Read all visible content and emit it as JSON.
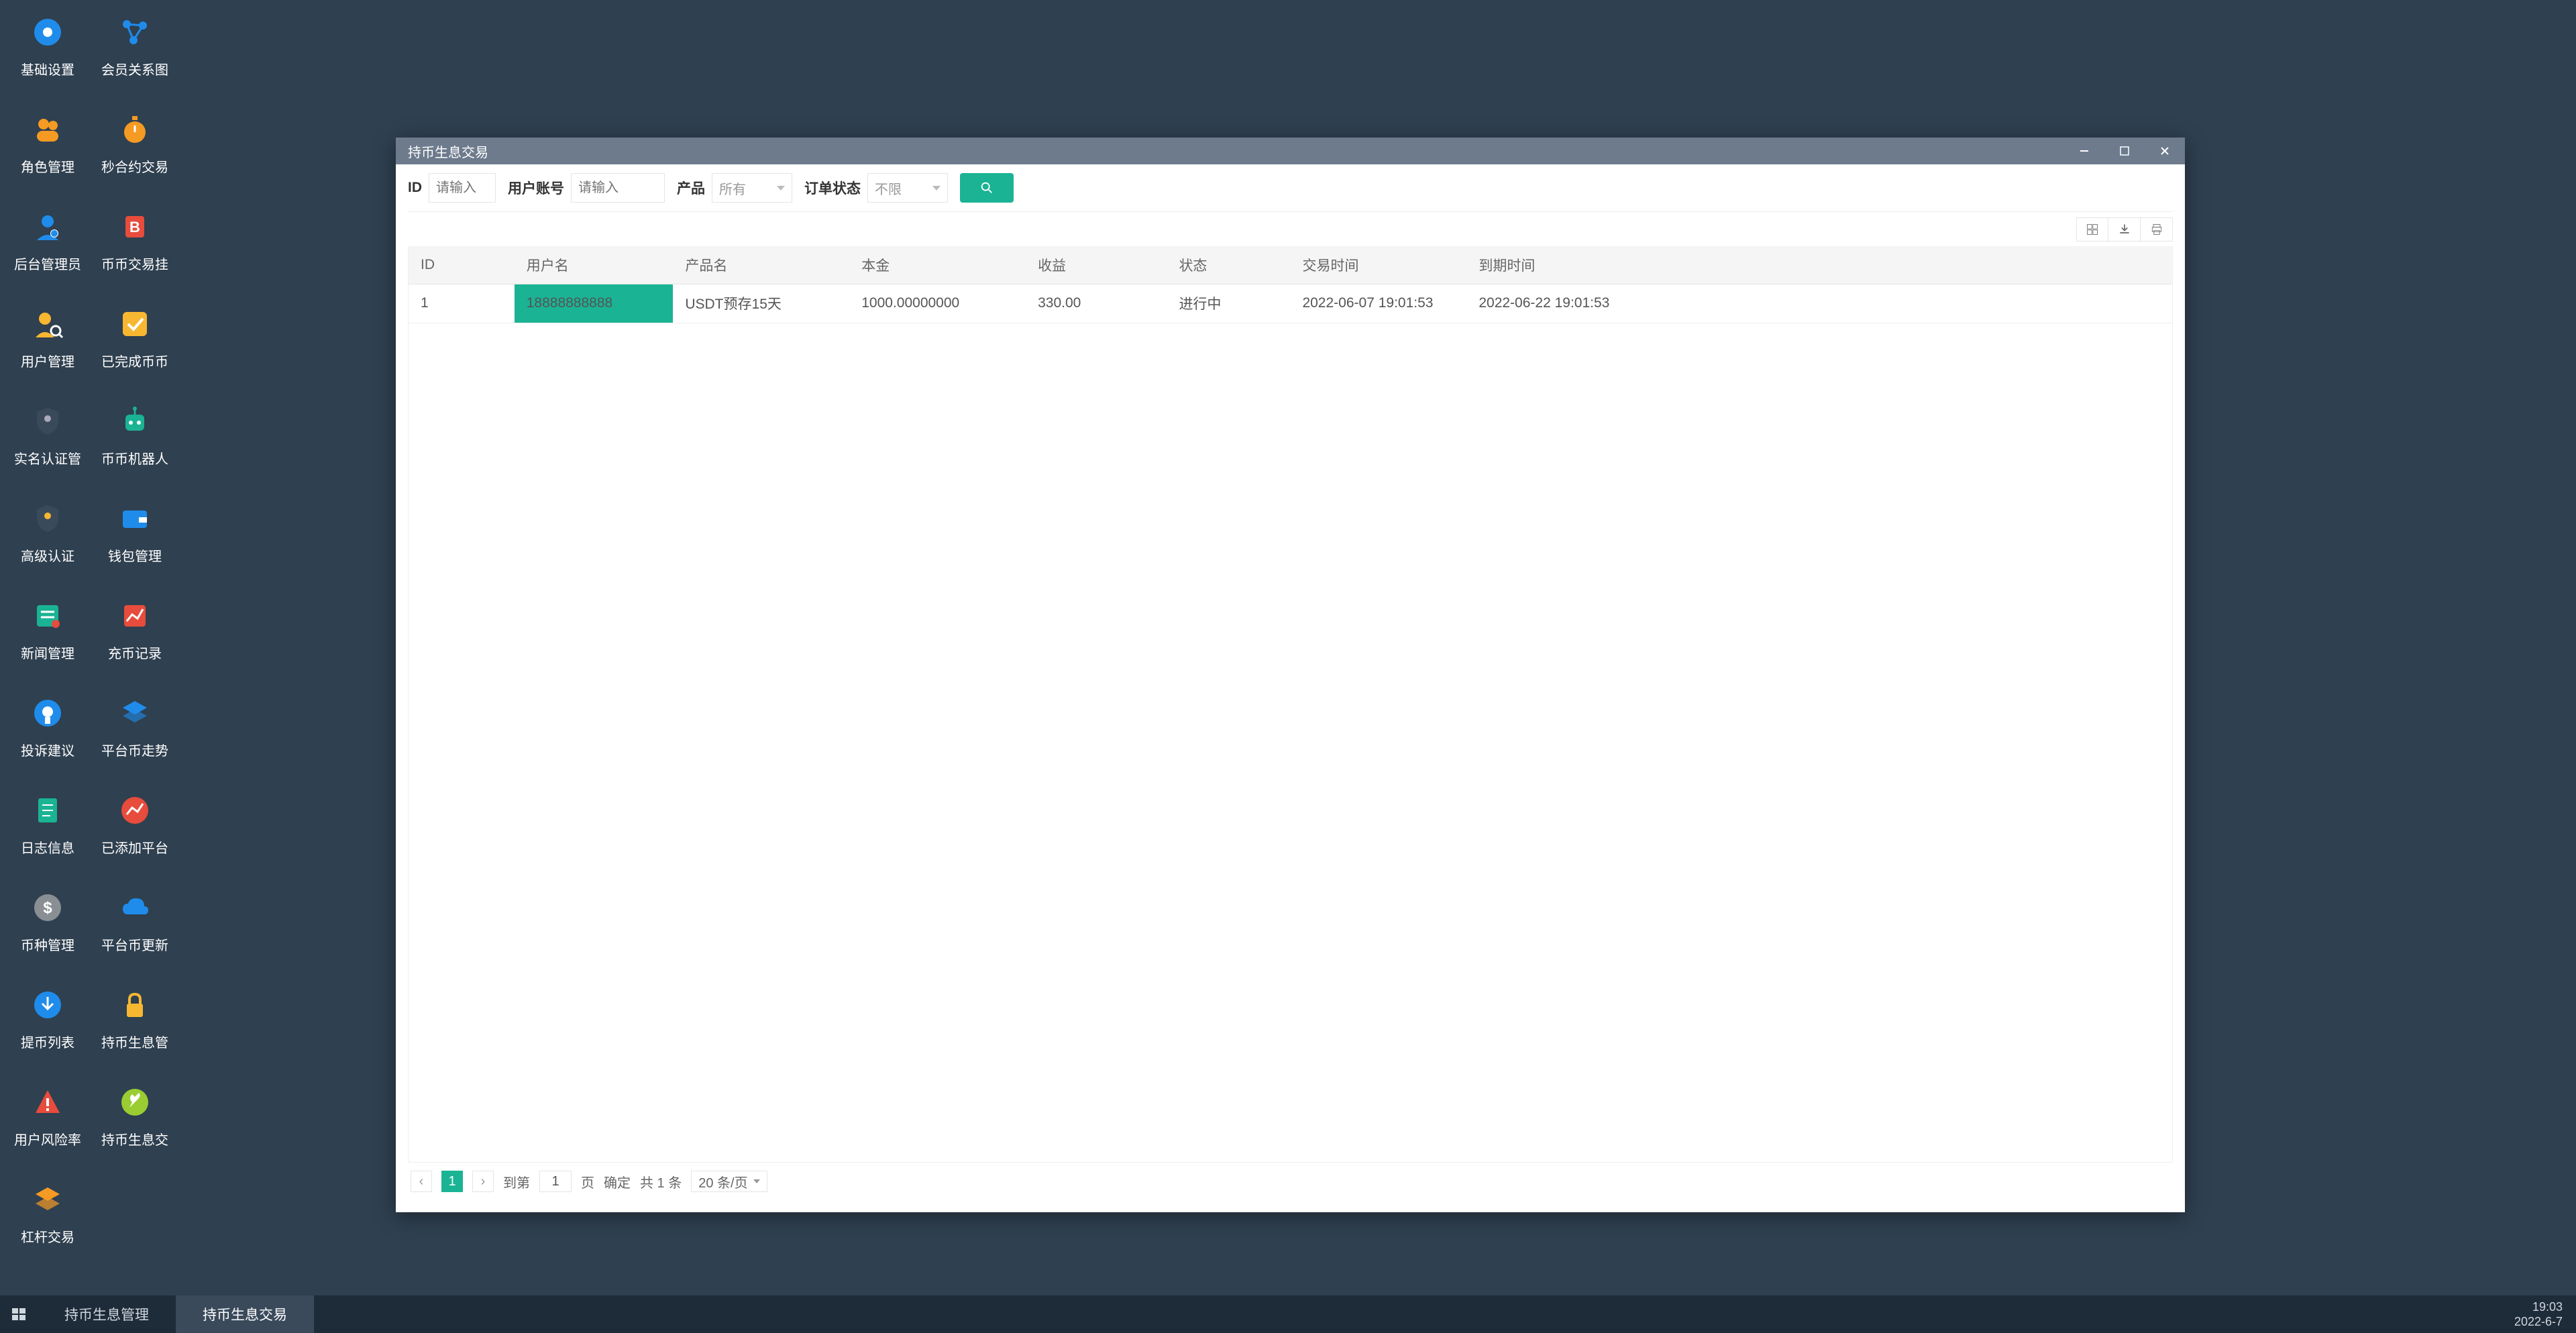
{
  "desktop_icons_col1": [
    {
      "label": "基础设置",
      "icon": "gear",
      "color": "#1f8ceb"
    },
    {
      "label": "角色管理",
      "icon": "users",
      "color": "#f59a23"
    },
    {
      "label": "后台管理员",
      "icon": "admin",
      "color": "#1f8ceb"
    },
    {
      "label": "用户管理",
      "icon": "usersearch",
      "color": "#f7b731"
    },
    {
      "label": "实名认证管",
      "icon": "shield",
      "color": "#3a4a5b"
    },
    {
      "label": "高级认证",
      "icon": "shield2",
      "color": "#3a4a5b"
    },
    {
      "label": "新闻管理",
      "icon": "news",
      "color": "#1ab394"
    },
    {
      "label": "投诉建议",
      "icon": "complain",
      "color": "#1f8ceb"
    },
    {
      "label": "日志信息",
      "icon": "log",
      "color": "#1ab394"
    },
    {
      "label": "币种管理",
      "icon": "dollar",
      "color": "#8a8f94"
    },
    {
      "label": "提币列表",
      "icon": "withdraw",
      "color": "#1f8ceb"
    },
    {
      "label": "用户风险率",
      "icon": "alert",
      "color": "#e74c3c"
    },
    {
      "label": "杠杆交易",
      "icon": "layers",
      "color": "#f59a23"
    }
  ],
  "desktop_icons_col2": [
    {
      "label": "会员关系图",
      "icon": "graph",
      "color": "#1f8ceb"
    },
    {
      "label": "秒合约交易",
      "icon": "timer",
      "color": "#f59a23"
    },
    {
      "label": "币币交易挂",
      "icon": "badge",
      "color": "#e74c3c"
    },
    {
      "label": "已完成币币",
      "icon": "check",
      "color": "#f7b731"
    },
    {
      "label": "币币机器人",
      "icon": "robot",
      "color": "#1ab394"
    },
    {
      "label": "钱包管理",
      "icon": "wallet",
      "color": "#1f8ceb"
    },
    {
      "label": "充币记录",
      "icon": "chart",
      "color": "#e74c3c"
    },
    {
      "label": "平台币走势",
      "icon": "trend",
      "color": "#1f8ceb"
    },
    {
      "label": "已添加平台",
      "icon": "chartcircle",
      "color": "#e74c3c"
    },
    {
      "label": "平台币更新",
      "icon": "cloud",
      "color": "#1f8ceb"
    },
    {
      "label": "持币生息管",
      "icon": "lock",
      "color": "#f7b731"
    },
    {
      "label": "持币生息交",
      "icon": "wrench",
      "color": "#9acd32"
    }
  ],
  "window": {
    "title": "持币生息交易",
    "filters": {
      "id_label": "ID",
      "id_placeholder": "请输入",
      "user_label": "用户账号",
      "user_placeholder": "请输入",
      "product_label": "产品",
      "product_value": "所有",
      "status_label": "订单状态",
      "status_value": "不限"
    },
    "columns": [
      "ID",
      "用户名",
      "产品名",
      "本金",
      "收益",
      "状态",
      "交易时间",
      "到期时间",
      ""
    ],
    "rows": [
      {
        "id": "1",
        "user": "18888888888",
        "product": "USDT预存15天",
        "principal": "1000.00000000",
        "profit": "330.00",
        "status": "进行中",
        "trade_time": "2022-06-07 19:01:53",
        "expire_time": "2022-06-22 19:01:53"
      }
    ],
    "pager": {
      "current": "1",
      "goto_label": "到第",
      "page_suffix": "页",
      "goto_value": "1",
      "confirm": "确定",
      "total": "共 1 条",
      "per_page": "20 条/页"
    }
  },
  "taskbar": {
    "items": [
      {
        "label": "持币生息管理",
        "active": false
      },
      {
        "label": "持币生息交易",
        "active": true
      }
    ],
    "time": "19:03",
    "date": "2022-6-7"
  }
}
